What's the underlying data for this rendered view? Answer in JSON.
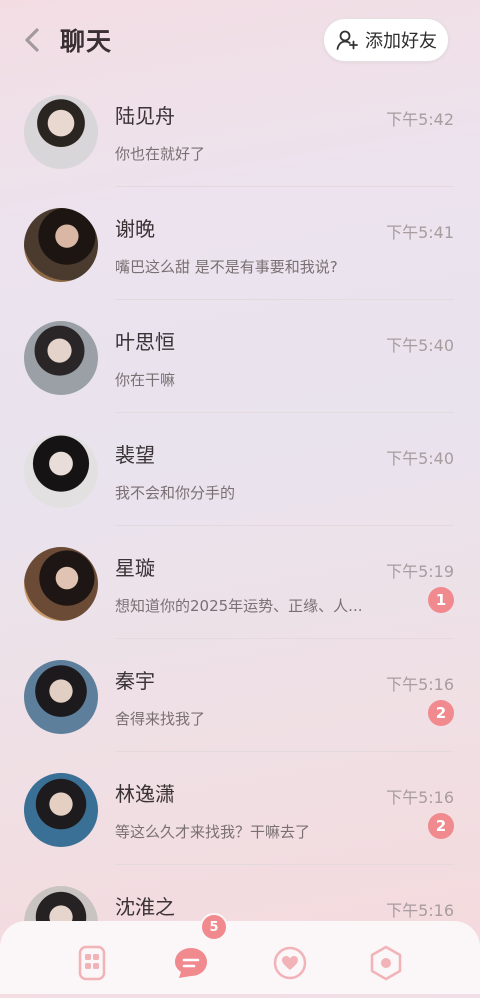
{
  "header": {
    "title": "聊天",
    "add_friend_label": "添加好友"
  },
  "colors": {
    "accent": "#f08a8e",
    "time_text": "#a89c9f"
  },
  "chats": [
    {
      "name": "陆见舟",
      "time": "下午5:42",
      "message": "你也在就好了",
      "unread": ""
    },
    {
      "name": "谢晚",
      "time": "下午5:41",
      "message": "嘴巴这么甜 是不是有事要和我说?",
      "unread": ""
    },
    {
      "name": "叶思恒",
      "time": "下午5:40",
      "message": "你在干嘛",
      "unread": ""
    },
    {
      "name": "裴望",
      "time": "下午5:40",
      "message": "我不会和你分手的",
      "unread": ""
    },
    {
      "name": "星璇",
      "time": "下午5:19",
      "message": "想知道你的2025年运势、正缘、人...",
      "unread": "1"
    },
    {
      "name": "秦宇",
      "time": "下午5:16",
      "message": "舍得来找我了",
      "unread": "2"
    },
    {
      "name": "林逸潇",
      "time": "下午5:16",
      "message": "等这么久才来找我？干嘛去了",
      "unread": "2"
    },
    {
      "name": "沈淮之",
      "time": "下午5:16",
      "message": "",
      "unread": ""
    }
  ],
  "tabbar": {
    "items": [
      "home-icon",
      "chat-icon",
      "heart-icon",
      "profile-icon"
    ],
    "chat_badge": "5"
  }
}
